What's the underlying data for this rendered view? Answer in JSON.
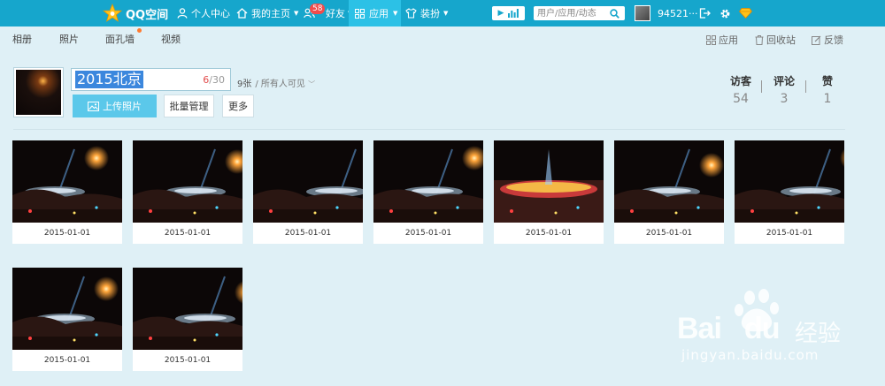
{
  "topbar": {
    "logo_text": "QQ空间",
    "nav": [
      {
        "label": "个人中心",
        "icon": "person-icon"
      },
      {
        "label": "我的主页",
        "icon": "home-icon"
      },
      {
        "label": "好友",
        "icon": "friends-icon",
        "badge": "58"
      },
      {
        "label": "应用",
        "icon": "apps-icon",
        "active": true
      },
      {
        "label": "装扮",
        "icon": "shirt-icon"
      }
    ],
    "search_placeholder": "用户/应用/动态",
    "username": "94521···",
    "colors": {
      "bar": "#16a6cc",
      "active": "#2cc1e6",
      "badge": "#f24b4b"
    }
  },
  "subnav": {
    "tabs": [
      "相册",
      "照片",
      "面孔墙",
      "视频"
    ],
    "right": [
      {
        "label": "应用",
        "icon": "grid-icon"
      },
      {
        "label": "回收站",
        "icon": "trash-icon"
      },
      {
        "label": "反馈",
        "icon": "edit-icon"
      }
    ]
  },
  "album": {
    "title": "2015北京",
    "char_count": "6",
    "char_max": "/30",
    "photo_count": "9张",
    "visibility": "/ 所有人可见",
    "upload_label": "上传照片",
    "batch_label": "批量管理",
    "more_label": "更多",
    "stats": [
      {
        "label": "访客",
        "value": "54"
      },
      {
        "label": "评论",
        "value": "3"
      },
      {
        "label": "赞",
        "value": "1"
      }
    ]
  },
  "photos": [
    {
      "date": "2015-01-01"
    },
    {
      "date": "2015-01-01"
    },
    {
      "date": "2015-01-01"
    },
    {
      "date": "2015-01-01"
    },
    {
      "date": "2015-01-01"
    },
    {
      "date": "2015-01-01"
    },
    {
      "date": "2015-01-01"
    },
    {
      "date": "2015-01-01"
    },
    {
      "date": "2015-01-01"
    }
  ],
  "watermark": {
    "brand": "Bai",
    "brand2": "du",
    "product": "经验",
    "url": "jingyan.baidu.com"
  }
}
